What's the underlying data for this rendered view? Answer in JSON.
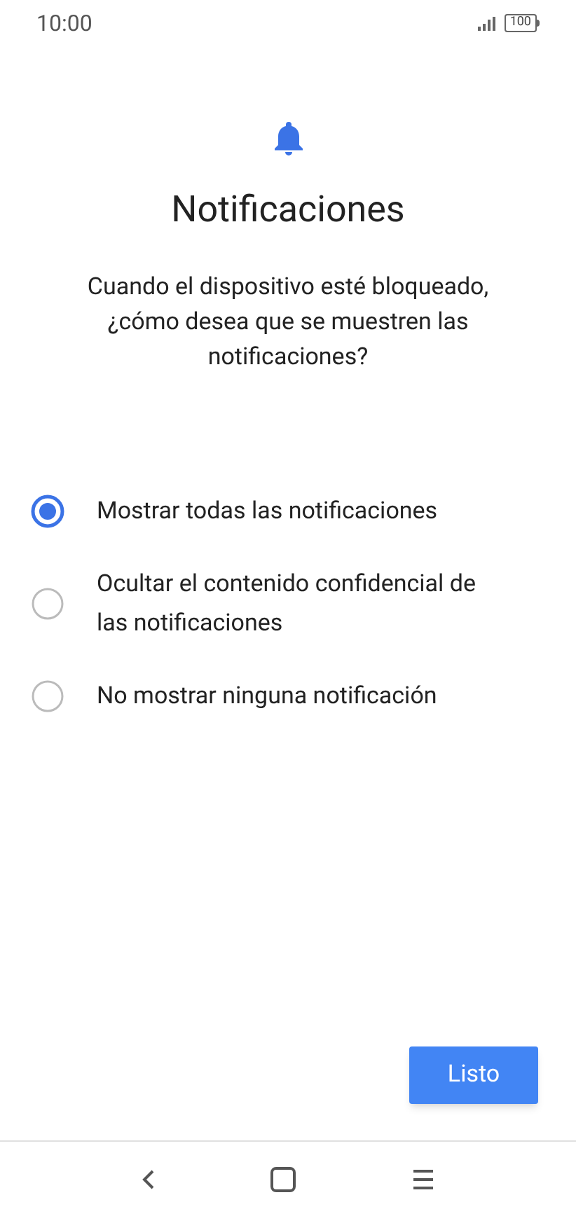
{
  "status_bar": {
    "time": "10:00",
    "battery": "100"
  },
  "title": "Notificaciones",
  "description": "Cuando el dispositivo esté bloqueado, ¿cómo desea que se muestren las notificaciones?",
  "options": [
    {
      "label": "Mostrar todas las notificaciones",
      "selected": true
    },
    {
      "label": "Ocultar el contenido confidencial de las notificaciones",
      "selected": false
    },
    {
      "label": "No mostrar ninguna notificación",
      "selected": false
    }
  ],
  "button": "Listo"
}
